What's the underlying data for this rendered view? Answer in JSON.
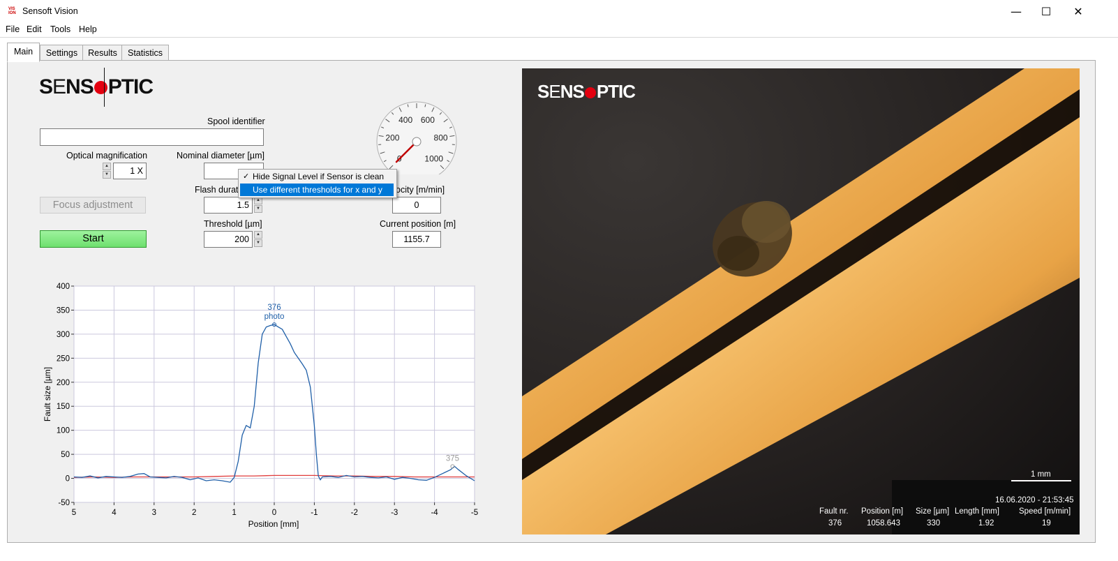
{
  "window": {
    "title": "Sensoft Vision",
    "icon_text": "VIS ION",
    "controls": [
      "minimize-icon",
      "maximize-icon",
      "close-icon"
    ]
  },
  "menu": [
    "File",
    "Edit",
    "Tools",
    "Help"
  ],
  "tabs": [
    {
      "label": "Main",
      "active": true
    },
    {
      "label": "Settings",
      "active": false
    },
    {
      "label": "Results",
      "active": false
    },
    {
      "label": "Statistics",
      "active": false
    }
  ],
  "logo": {
    "left": "S",
    "strike": "E",
    "mid": "NS",
    "right": "PTIC"
  },
  "controls": {
    "spool_identifier": {
      "label": "Spool identifier",
      "value": ""
    },
    "optical_magnification": {
      "label": "Optical magnification",
      "value": "1 X"
    },
    "nominal_diameter": {
      "label": "Nominal diameter [µm]",
      "value": ""
    },
    "flash_duration": {
      "label": "Flash duratio",
      "value": "1.5"
    },
    "threshold": {
      "label": "Threshold [µm]",
      "value": "200"
    },
    "velocity": {
      "label": "ocity [m/min]",
      "value": "0"
    },
    "current_position": {
      "label": "Current position [m]",
      "value": "1155.7"
    },
    "focus_button": "Focus adjustment",
    "start_button": "Start"
  },
  "gauge": {
    "ticks": [
      "0",
      "200",
      "400",
      "600",
      "800",
      "1000"
    ],
    "min": 0,
    "max": 1000,
    "value": 0
  },
  "context_menu": {
    "items": [
      {
        "label": "Hide Signal Level if Sensor is clean",
        "checked": true,
        "highlighted": false
      },
      {
        "label": "Use different thresholds for x and y",
        "checked": false,
        "highlighted": true
      }
    ],
    "check_glyph": "✓"
  },
  "chart_data": {
    "type": "line",
    "xlabel": "Position [mm]",
    "ylabel": "Fault size [µm]",
    "xlim": [
      5,
      -5
    ],
    "ylim": [
      -50,
      400
    ],
    "x_ticks": [
      5,
      4,
      3,
      2,
      1,
      0,
      -1,
      -2,
      -3,
      -4,
      -5
    ],
    "y_ticks": [
      -50,
      0,
      50,
      100,
      150,
      200,
      250,
      300,
      350,
      400
    ],
    "grid": true,
    "series": [
      {
        "color": "#1f5fa8",
        "x": [
          5.0,
          4.8,
          4.6,
          4.4,
          4.2,
          4.0,
          3.8,
          3.6,
          3.4,
          3.25,
          3.1,
          2.9,
          2.7,
          2.5,
          2.3,
          2.1,
          1.9,
          1.7,
          1.5,
          1.3,
          1.1,
          1.0,
          0.9,
          0.8,
          0.7,
          0.6,
          0.5,
          0.4,
          0.3,
          0.2,
          0.1,
          0.0,
          -0.1,
          -0.2,
          -0.3,
          -0.4,
          -0.5,
          -0.6,
          -0.7,
          -0.8,
          -0.9,
          -1.0,
          -1.05,
          -1.1,
          -1.15,
          -1.2,
          -1.4,
          -1.6,
          -1.8,
          -2.0,
          -2.2,
          -2.4,
          -2.6,
          -2.8,
          -3.0,
          -3.2,
          -3.4,
          -3.6,
          -3.8,
          -4.0,
          -4.2,
          -4.4,
          -4.5,
          -4.6,
          -4.8,
          -5.0
        ],
        "y": [
          3,
          2,
          5,
          1,
          4,
          3,
          2,
          4,
          9,
          10,
          3,
          2,
          1,
          4,
          2,
          -3,
          1,
          -5,
          -3,
          -5,
          -8,
          2,
          35,
          90,
          110,
          105,
          150,
          240,
          300,
          315,
          318,
          320,
          315,
          310,
          295,
          280,
          262,
          250,
          238,
          225,
          190,
          110,
          50,
          5,
          -3,
          3,
          4,
          2,
          6,
          3,
          4,
          2,
          1,
          3,
          -2,
          2,
          0,
          -3,
          -4,
          2,
          10,
          18,
          25,
          18,
          5,
          -5
        ]
      },
      {
        "color": "#e03c3c",
        "x": [
          5.0,
          4.5,
          4.0,
          3.5,
          3.0,
          2.5,
          2.0,
          1.5,
          1.0,
          0.5,
          0.0,
          -0.5,
          -1.0,
          -1.5,
          -2.0,
          -2.5,
          -3.0,
          -3.5,
          -4.0,
          -4.5,
          -5.0
        ],
        "y": [
          2,
          3,
          2,
          3,
          3,
          3,
          3,
          4,
          5,
          5,
          6,
          6,
          6,
          5,
          5,
          4,
          4,
          3,
          3,
          3,
          3
        ]
      }
    ],
    "annotations": [
      {
        "x": 0.0,
        "y": 320,
        "lines": [
          "376",
          "photo"
        ],
        "color": "#1f5fa8"
      },
      {
        "x": -4.45,
        "y": 25,
        "lines": [
          "375"
        ],
        "color": "#9a9a9a"
      }
    ]
  },
  "photo": {
    "logo_color": "#ffffff",
    "scale_bar_label": "1 mm",
    "timestamp": "16.06.2020 - 21:53:45",
    "info_headers": [
      "Fault nr.",
      "Position [m]",
      "Size [µm]",
      "Length [mm]",
      "Speed [m/min]"
    ],
    "info_values": [
      "376",
      "1058.643",
      "330",
      "1.92",
      "19"
    ]
  }
}
